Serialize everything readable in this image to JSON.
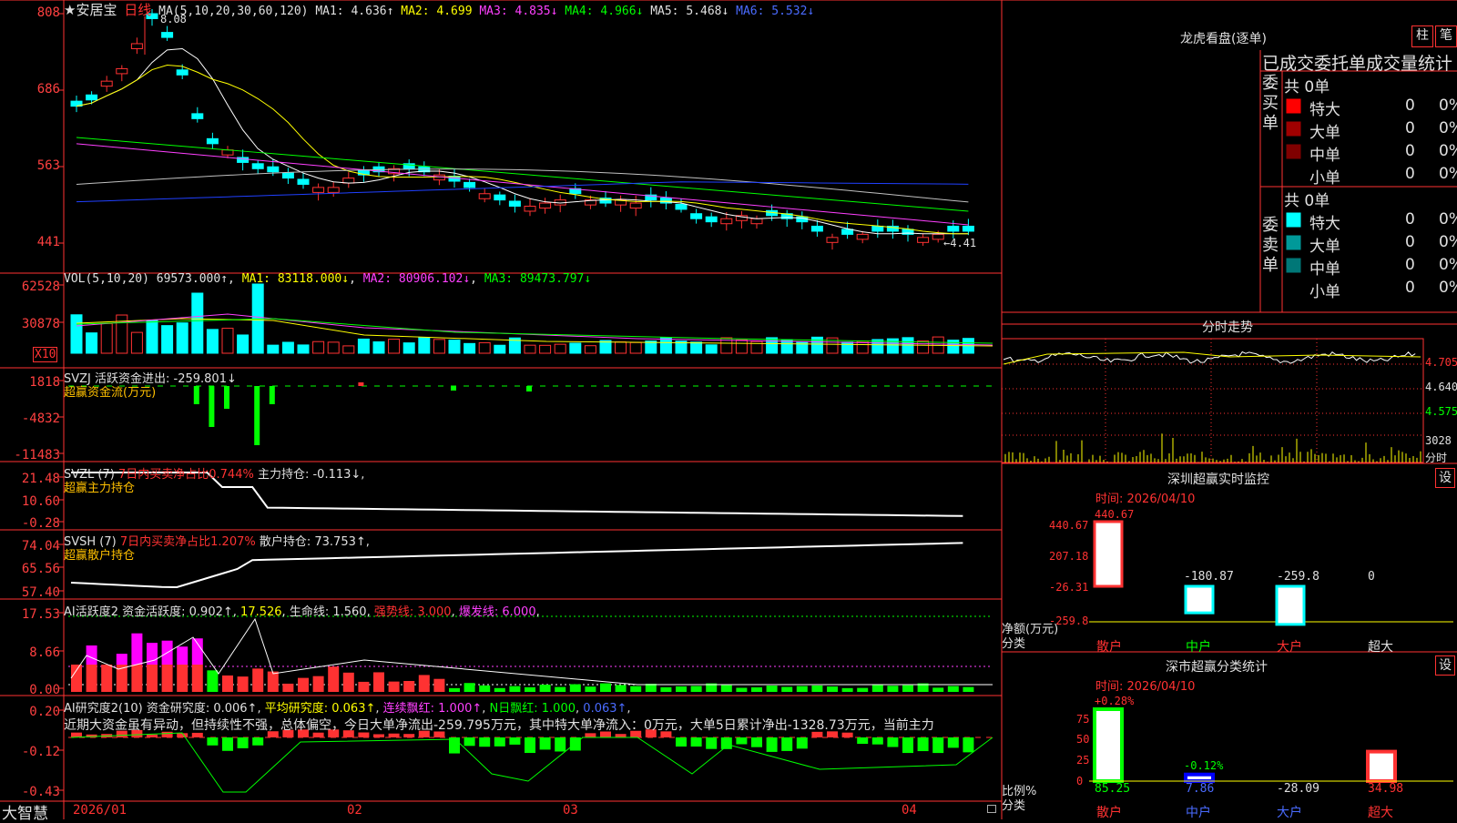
{
  "main": {
    "title": "★安居宝",
    "period": "日线",
    "ma_label": "MA(5,10,20,30,60,120)",
    "ma1": "MA1: 4.636↑",
    "ma2": "MA2: 4.699",
    "ma3": "MA3: 4.835↓",
    "ma4": "MA4: 4.966↓",
    "ma5": "MA5: 5.468↓",
    "ma6": "MA6: 5.532↓",
    "high_mark": "8.08",
    "low_mark": "←4.41",
    "yticks": [
      "808",
      "686",
      "563",
      "441"
    ]
  },
  "vol": {
    "label": "VOL(5,10,20)",
    "value": "69573.000↑",
    "ma1": "MA1: 83118.000↓",
    "ma2": "MA2: 80906.102↓",
    "ma3": "MA3: 89473.797↓",
    "unit": "X10",
    "yticks": [
      "62528",
      "30878"
    ]
  },
  "svzj": {
    "label": "SVZJ  活跃资金进出: -259.801↓",
    "sub": "超赢资金流(万元)",
    "yticks": [
      "1818",
      "-4832",
      "-11483"
    ]
  },
  "svzl": {
    "label": "SVZL (7)",
    "ratio": "7日内买卖净占比0.744%",
    "pos": "主力持仓: -0.113↓",
    "sub": "超赢主力持仓",
    "yticks": [
      "21.48",
      "10.60",
      "-0.28"
    ]
  },
  "svsh": {
    "label": "SVSH (7)",
    "ratio": "7日内买卖净占比1.207%",
    "pos": "散户持仓: 73.753↑",
    "sub": "超赢散户持仓",
    "yticks": [
      "74.04",
      "65.56",
      "57.40"
    ]
  },
  "ai1": {
    "label": "AI活跃度2",
    "act": "资金活跃度: 0.902↑",
    "v2": "17.526",
    "life": "生命线: 1.560",
    "strong": "强势线: 3.000",
    "burst": "爆发线: 6.000",
    "yticks": [
      "17.53",
      "8.66",
      "0.00"
    ]
  },
  "ai2": {
    "label": "AI研究度2(10)",
    "res": "资金研究度: 0.006↑",
    "avg": "平均研究度: 0.063↑",
    "cont": "连续飘红: 1.000↑",
    "nday": "N日飘红: 1.000",
    "last": "0.063↑",
    "comment": "近期大资金虽有异动，但持续性不强，总体偏空，今日大单净流出-259.795万元，其中特大单净流入：0万元，大单5日累计净出-1328.73万元，当前主力",
    "yticks": [
      "0.20",
      "-0.12",
      "-0.43"
    ]
  },
  "xaxis": {
    "brand": "大智慧",
    "dates": [
      "2026/01",
      "02",
      "03",
      "04"
    ]
  },
  "lhb": {
    "title": "龙虎看盘(逐单)",
    "btn_bar": "柱",
    "btn_pen": "笔",
    "header": "已成交委托单成交量统计",
    "buy_label": "委买单",
    "sell_label": "委卖单",
    "buy_total": "共 0单",
    "sell_total": "共 0单",
    "buy_rows": [
      {
        "name": "特大",
        "count": "0",
        "pct": "0%",
        "color": "#ff0000"
      },
      {
        "name": "大单",
        "count": "0",
        "pct": "0%",
        "color": "#a00000"
      },
      {
        "name": "中单",
        "count": "0",
        "pct": "0%",
        "color": "#800000"
      },
      {
        "name": "小单",
        "count": "0",
        "pct": "0%",
        "color": "#000000"
      }
    ],
    "sell_rows": [
      {
        "name": "特大",
        "count": "0",
        "pct": "0%",
        "color": "#00ffff"
      },
      {
        "name": "大单",
        "count": "0",
        "pct": "0%",
        "color": "#009999"
      },
      {
        "name": "中单",
        "count": "0",
        "pct": "0%",
        "color": "#007777"
      },
      {
        "name": "小单",
        "count": "0",
        "pct": "0%",
        "color": "#000000"
      }
    ]
  },
  "intraday": {
    "title": "分时走势",
    "p1": "4.705",
    "p2": "4.640",
    "p3": "4.575",
    "vol": "3028",
    "unit": "分时"
  },
  "monitor": {
    "title": "深圳超赢实时监控",
    "btn": "设",
    "time": "时间: 2026/04/10",
    "yticks": [
      "440.67",
      "207.18",
      "-26.31",
      "-259.8"
    ],
    "ylabel": "净额(万元)",
    "xlabel": "分类",
    "top_value": "440.67",
    "chart_data": {
      "type": "bar",
      "categories": [
        "散户",
        "中户",
        "大户",
        "超大"
      ],
      "values": [
        440.67,
        -180.87,
        -259.8,
        0
      ],
      "value_labels": [
        "440.67",
        "-180.87",
        "-259.8",
        "0"
      ],
      "ylim": [
        -259.8,
        440.67
      ]
    }
  },
  "classify": {
    "title": "深市超赢分类统计",
    "btn": "设",
    "time": "时间: 2026/04/10",
    "yticks": [
      "75",
      "50",
      "25",
      "0"
    ],
    "ylabel": "比例%",
    "xlabel": "分类",
    "chart_data": {
      "type": "bar",
      "categories": [
        "散户",
        "中户",
        "大户",
        "超大"
      ],
      "values": [
        85.25,
        7.86,
        -28.09,
        34.98
      ],
      "change_labels": [
        "+0.28%",
        "-0.12%",
        "",
        ""
      ],
      "value_labels": [
        "85.25",
        "7.86",
        "-28.09",
        "34.98"
      ],
      "ylim": [
        0,
        85.25
      ]
    }
  }
}
